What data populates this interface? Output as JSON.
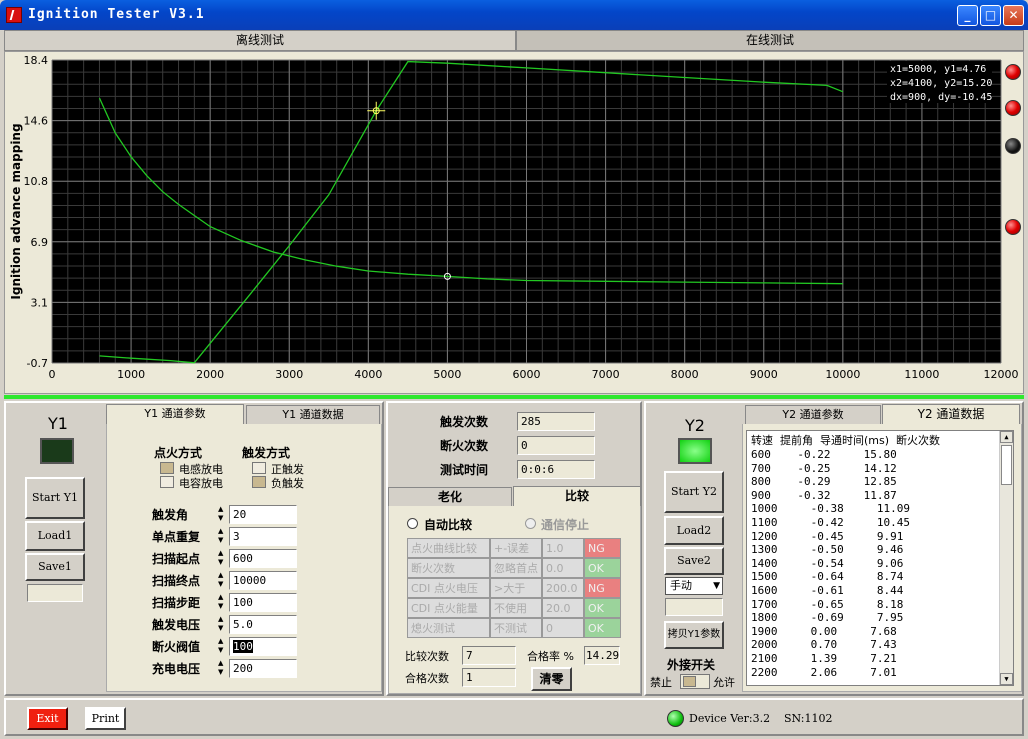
{
  "window": {
    "title": "Ignition Tester V3.1"
  },
  "top_tabs": [
    "离线测试",
    "在线测试"
  ],
  "chart_data": {
    "type": "line",
    "ylabel": "Ignition advance mapping",
    "xlim": [
      0,
      12000
    ],
    "ylim": [
      -0.7,
      18.4
    ],
    "x_ticks": [
      "0",
      "1000",
      "2000",
      "3000",
      "4000",
      "5000",
      "6000",
      "7000",
      "8000",
      "9000",
      "10000",
      "11000",
      "12000"
    ],
    "y_ticks": [
      "18.4",
      "14.6",
      "10.8",
      "6.9",
      "3.1",
      "-0.7"
    ],
    "grid": true,
    "series": [
      {
        "points": [
          [
            600,
            16.0
          ],
          [
            800,
            13.8
          ],
          [
            1000,
            12.3
          ],
          [
            1200,
            11.1
          ],
          [
            1400,
            10.1
          ],
          [
            1600,
            9.3
          ],
          [
            1800,
            8.6
          ],
          [
            2000,
            7.9
          ],
          [
            2400,
            7.0
          ],
          [
            2800,
            6.3
          ],
          [
            3200,
            5.8
          ],
          [
            3600,
            5.4
          ],
          [
            4000,
            5.1
          ],
          [
            4500,
            4.9
          ],
          [
            5000,
            4.76
          ],
          [
            5500,
            4.6
          ],
          [
            6000,
            4.5
          ],
          [
            7000,
            4.45
          ],
          [
            8000,
            4.4
          ],
          [
            9000,
            4.35
          ],
          [
            10000,
            4.3
          ]
        ]
      },
      {
        "points": [
          [
            600,
            -0.25
          ],
          [
            1000,
            -0.4
          ],
          [
            1500,
            -0.55
          ],
          [
            1800,
            -0.69
          ],
          [
            2500,
            3.6
          ],
          [
            3000,
            6.7
          ],
          [
            3500,
            9.9
          ],
          [
            4100,
            15.2
          ],
          [
            4500,
            18.3
          ],
          [
            5000,
            18.2
          ],
          [
            6000,
            17.9
          ],
          [
            7000,
            17.6
          ],
          [
            8000,
            17.3
          ],
          [
            9000,
            17.0
          ],
          [
            9800,
            16.8
          ],
          [
            10000,
            16.4
          ]
        ]
      }
    ],
    "cursors": [
      {
        "x": 5000,
        "y": 4.76
      },
      {
        "x": 4100,
        "y": 15.2
      }
    ],
    "readout": [
      "x1=5000, y1=4.76",
      "x2=4100, y2=15.20",
      "dx=900, dy=-10.45"
    ]
  },
  "y1": {
    "title": "Y1",
    "tabs": [
      "Y1 通道参数",
      "Y1 通道数据"
    ],
    "buttons": {
      "start": "Start Y1",
      "load": "Load1",
      "save": "Save1"
    },
    "ignition_mode": {
      "label": "点火方式",
      "options": [
        "电感放电",
        "电容放电"
      ]
    },
    "trigger_mode": {
      "label": "触发方式",
      "options": [
        "正触发",
        "负触发"
      ]
    },
    "params": [
      {
        "label": "触发角",
        "value": "20"
      },
      {
        "label": "单点重复",
        "value": "3"
      },
      {
        "label": "扫描起点",
        "value": "600"
      },
      {
        "label": "扫描终点",
        "value": "10000"
      },
      {
        "label": "扫描步距",
        "value": "100"
      },
      {
        "label": "触发电压",
        "value": "5.0"
      },
      {
        "label": "断火阀值",
        "value": "100"
      },
      {
        "label": "充电电压",
        "value": "200"
      }
    ]
  },
  "stats": [
    {
      "label": "触发次数",
      "value": "285"
    },
    {
      "label": "断火次数",
      "value": "0"
    },
    {
      "label": "测试时间",
      "value": "0:0:6"
    }
  ],
  "compare": {
    "tabs": [
      "老化",
      "比较"
    ],
    "radios": [
      "自动比较",
      "通信停止"
    ],
    "rows": [
      {
        "name": "点火曲线比较",
        "cond": "+-误差",
        "val": "1.0",
        "res": "NG"
      },
      {
        "name": "断火次数",
        "cond": "忽略首点",
        "val": "0.0",
        "res": "OK"
      },
      {
        "name": "CDI 点火电压",
        "cond": ">大于",
        "val": "200.0",
        "res": "NG"
      },
      {
        "name": "CDI 点火能量",
        "cond": "不使用",
        "val": "20.0",
        "res": "OK"
      },
      {
        "name": "熄火测试",
        "cond": "不测试",
        "val": "0",
        "res": "OK"
      }
    ],
    "compare_count_label": "比较次数",
    "compare_count": "7",
    "pass_count_label": "合格次数",
    "pass_count": "1",
    "pass_rate_label": "合格率 %",
    "pass_rate": "14.29",
    "clear_label": "清零"
  },
  "y2": {
    "title": "Y2",
    "tabs": [
      "Y2 通道参数",
      "Y2 通道数据"
    ],
    "buttons": {
      "start": "Start Y2",
      "load": "Load2",
      "save": "Save2",
      "copy": "拷贝Y1参数"
    },
    "mode": "手动",
    "ext_switch": {
      "label": "外接开关",
      "off": "禁止",
      "on": "允许"
    },
    "table_header": "转速  提前角  导通时间(ms)  断火次数",
    "rows": [
      "600    -0.22     15.80",
      "700    -0.25     14.12",
      "800    -0.29     12.85",
      "900    -0.32     11.87",
      "1000     -0.38     11.09",
      "1100     -0.42     10.45",
      "1200     -0.45     9.91",
      "1300     -0.50     9.46",
      "1400     -0.54     9.06",
      "1500     -0.64     8.74",
      "1600     -0.61     8.44",
      "1700     -0.65     8.18",
      "1800     -0.69     7.95",
      "1900     0.00     7.68",
      "2000     0.70     7.43",
      "2100     1.39     7.21",
      "2200     2.06     7.01"
    ]
  },
  "status": {
    "exit": "Exit",
    "print": "Print",
    "device": "Device Ver:3.2",
    "sn": "SN:1102"
  }
}
